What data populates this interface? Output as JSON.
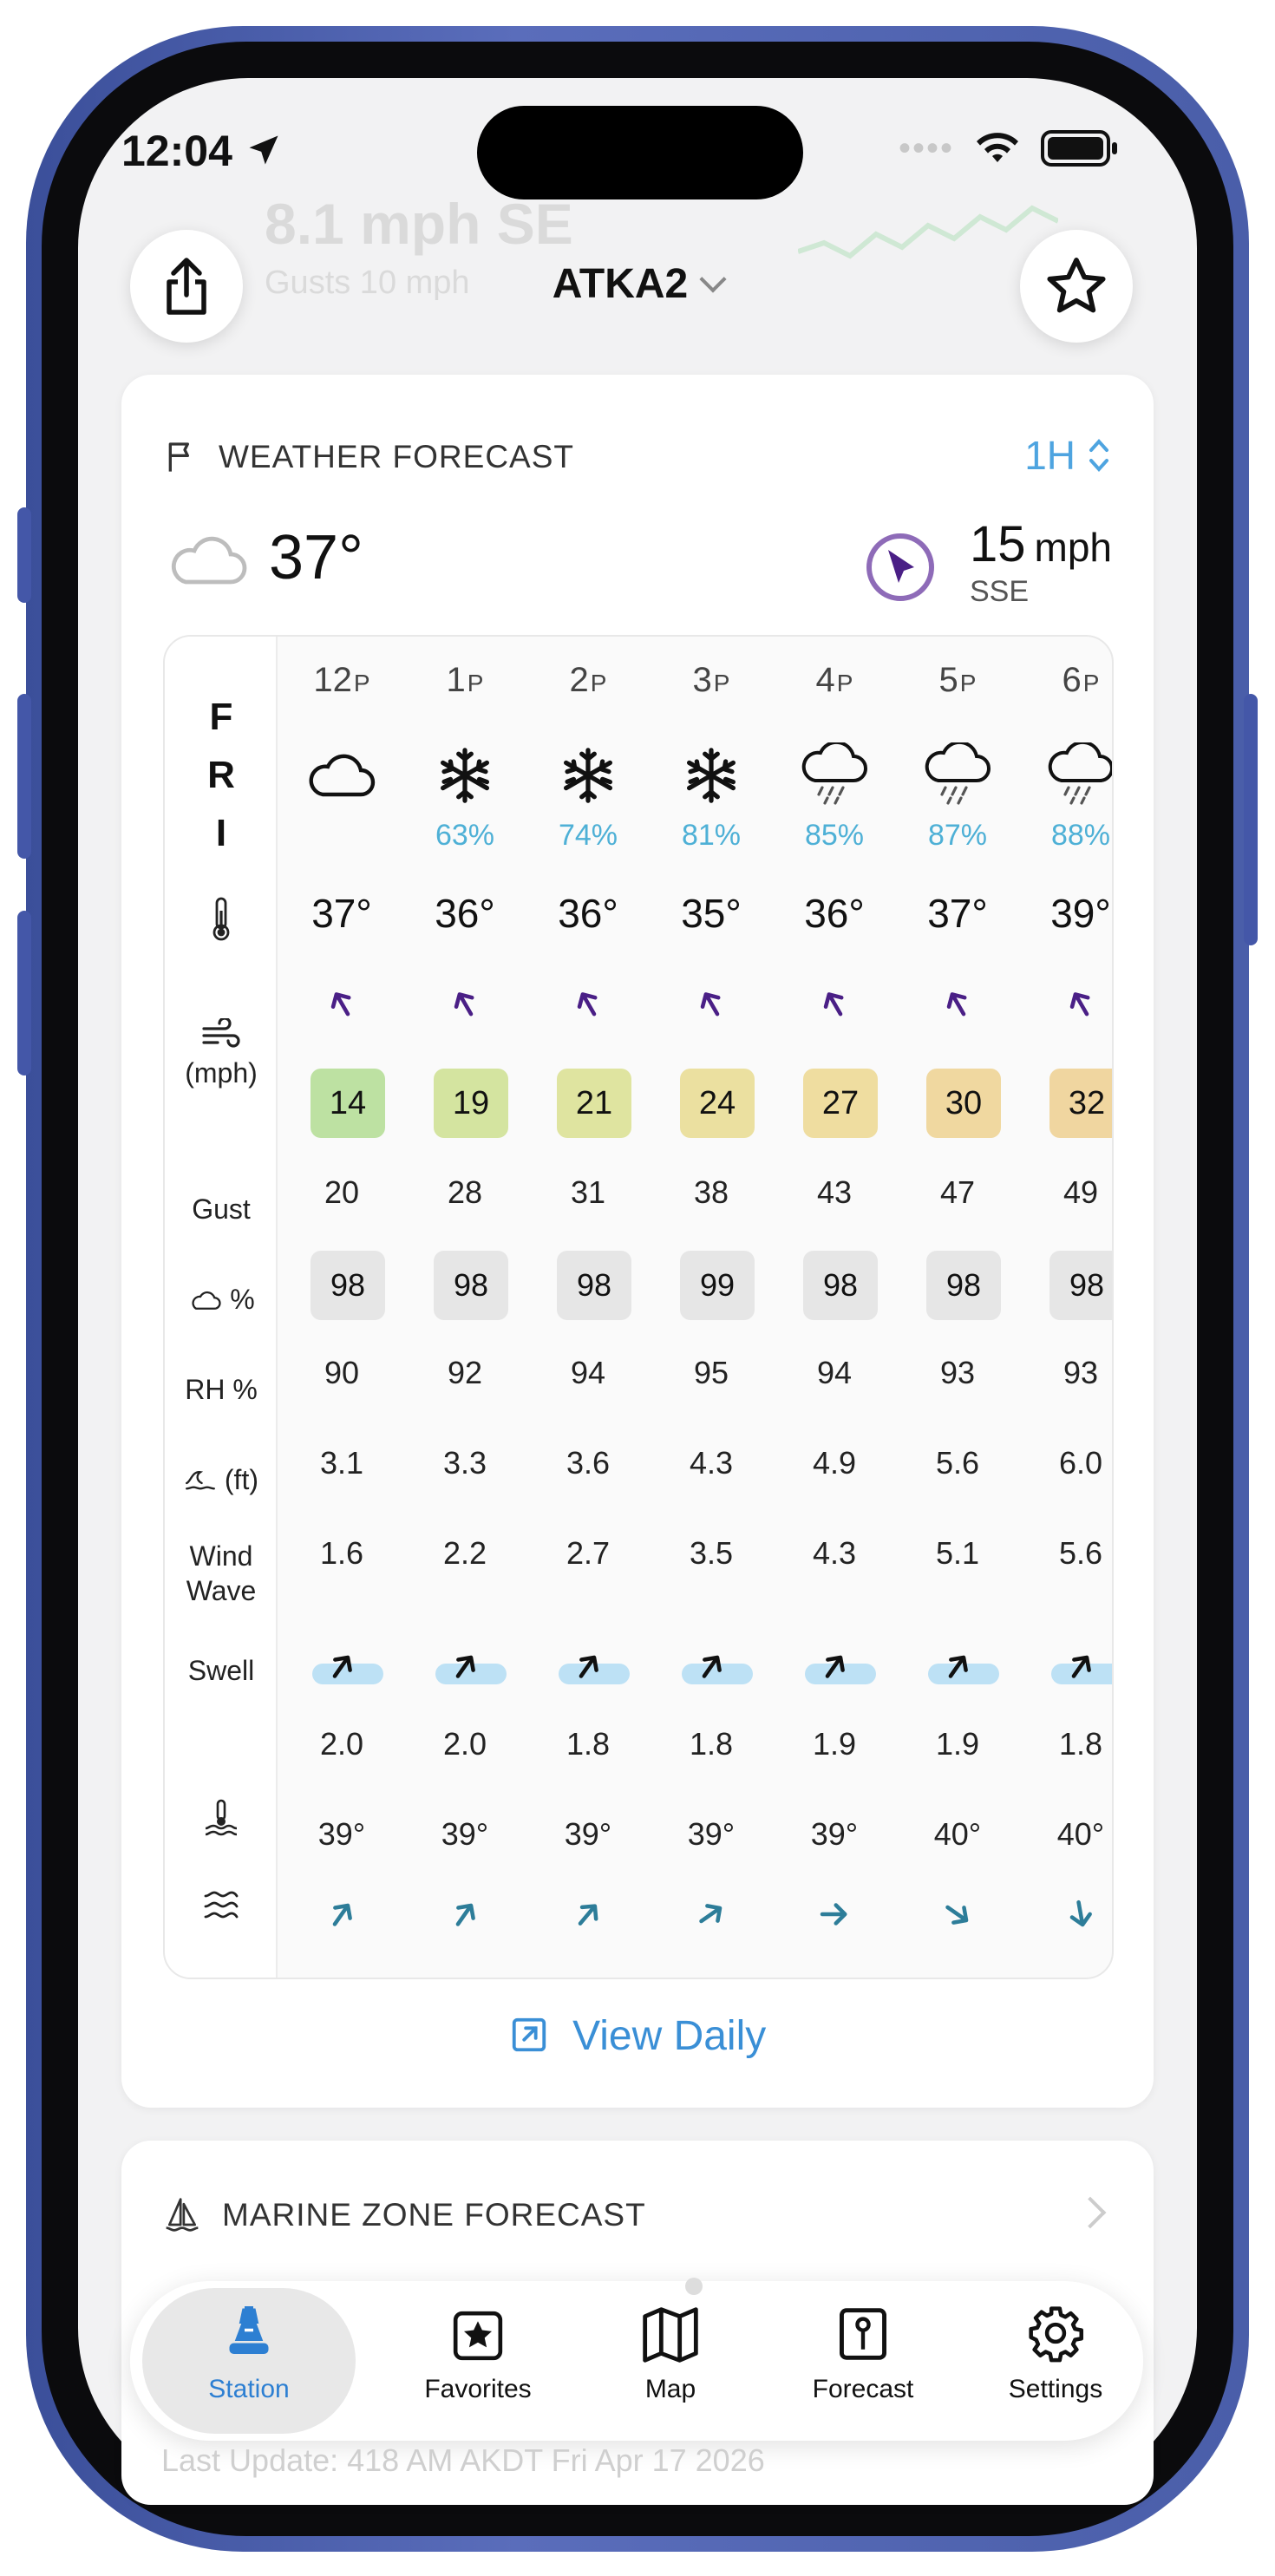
{
  "status": {
    "time": "12:04"
  },
  "background_ghost": {
    "speed": "8.1 mph SE",
    "gusts": "Gusts 10 mph"
  },
  "header": {
    "station": "ATKA2"
  },
  "forecast_card": {
    "title": "WEATHER FORECAST",
    "interval": "1H",
    "current_temp": "37°",
    "current_wind_speed": "15",
    "current_wind_unit": "mph",
    "current_wind_dir": "SSE",
    "day_letters": [
      "F",
      "R",
      "I"
    ],
    "row_labels": {
      "wind_unit": "(mph)",
      "gust": "Gust",
      "cloud_pct": "%",
      "rh": "RH %",
      "wave_unit": "(ft)",
      "wind_wave_1": "Wind",
      "wind_wave_2": "Wave",
      "swell": "Swell"
    },
    "columns": [
      {
        "hour": "12",
        "ampm": "P",
        "icon": "cloud",
        "precip": "",
        "temp": "37°",
        "wind": "14",
        "wind_color": "#bde1a2",
        "gust": "20",
        "cloud": "98",
        "rh": "90",
        "wave": "3.1",
        "wind_wave": "1.6",
        "swell": "2.0",
        "water_temp": "39°",
        "current_dir": 35
      },
      {
        "hour": "1",
        "ampm": "P",
        "icon": "snow",
        "precip": "63%",
        "temp": "36°",
        "wind": "19",
        "wind_color": "#d4e4a0",
        "gust": "28",
        "cloud": "98",
        "rh": "92",
        "wave": "3.3",
        "wind_wave": "2.2",
        "swell": "2.0",
        "water_temp": "39°",
        "current_dir": 35
      },
      {
        "hour": "2",
        "ampm": "P",
        "icon": "snow",
        "precip": "74%",
        "temp": "36°",
        "wind": "21",
        "wind_color": "#dfe4a0",
        "gust": "31",
        "cloud": "98",
        "rh": "94",
        "wave": "3.6",
        "wind_wave": "2.7",
        "swell": "1.8",
        "water_temp": "39°",
        "current_dir": 40
      },
      {
        "hour": "3",
        "ampm": "P",
        "icon": "snow",
        "precip": "81%",
        "temp": "35°",
        "wind": "24",
        "wind_color": "#ebe0a0",
        "gust": "38",
        "cloud": "99",
        "rh": "95",
        "wave": "4.3",
        "wind_wave": "3.5",
        "swell": "1.8",
        "water_temp": "39°",
        "current_dir": 55
      },
      {
        "hour": "4",
        "ampm": "P",
        "icon": "rain",
        "precip": "85%",
        "temp": "36°",
        "wind": "27",
        "wind_color": "#efdda0",
        "gust": "43",
        "cloud": "98",
        "rh": "94",
        "wave": "4.9",
        "wind_wave": "4.3",
        "swell": "1.9",
        "water_temp": "39°",
        "current_dir": 90
      },
      {
        "hour": "5",
        "ampm": "P",
        "icon": "rain",
        "precip": "87%",
        "temp": "37°",
        "wind": "30",
        "wind_color": "#f0d8a0",
        "gust": "47",
        "cloud": "98",
        "rh": "93",
        "wave": "5.6",
        "wind_wave": "5.1",
        "swell": "1.9",
        "water_temp": "40°",
        "current_dir": 125
      },
      {
        "hour": "6",
        "ampm": "P",
        "icon": "rain",
        "precip": "88%",
        "temp": "39°",
        "wind": "32",
        "wind_color": "#f0d6a0",
        "gust": "49",
        "cloud": "98",
        "rh": "93",
        "wave": "6.0",
        "wind_wave": "5.6",
        "swell": "1.8",
        "water_temp": "40°",
        "current_dir": 170
      }
    ],
    "view_daily": "View Daily"
  },
  "marine_card": {
    "title": "MARINE ZONE FORECAST"
  },
  "tabs": [
    {
      "label": "Station",
      "icon": "buoy-icon"
    },
    {
      "label": "Favorites",
      "icon": "star-square-icon"
    },
    {
      "label": "Map",
      "icon": "map-icon"
    },
    {
      "label": "Forecast",
      "icon": "forecast-icon"
    },
    {
      "label": "Settings",
      "icon": "gear-icon"
    }
  ],
  "last_update": "Last Update: 418 AM AKDT Fri Apr 17 2026"
}
